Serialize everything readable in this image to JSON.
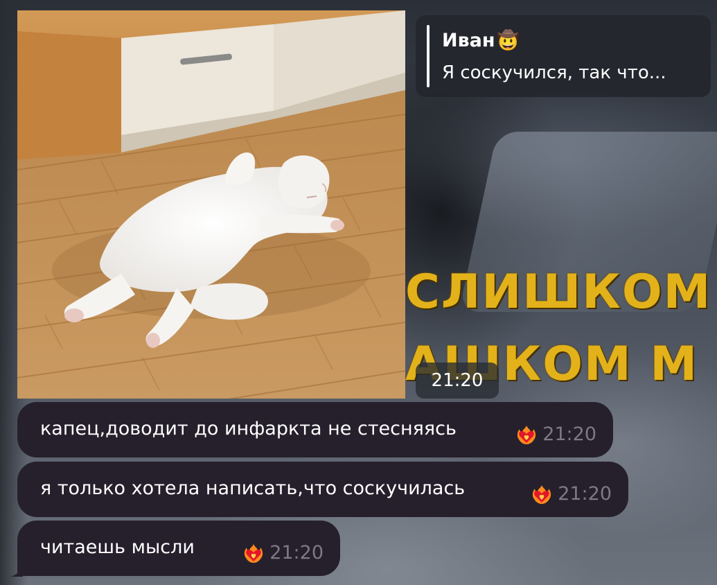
{
  "wallpaper": {
    "subtitle_line1": "СЛИШКОМ М",
    "subtitle_line2": "АШКОМ М"
  },
  "photo_message": {
    "time": "21:20"
  },
  "reply": {
    "author_name": "Иван",
    "author_emoji": "🤠",
    "text": "Я соскучился, так что..."
  },
  "messages": [
    {
      "text": "капец,доводит до инфаркта не стесняясь",
      "reaction": "heart-on-fire",
      "time": "21:20"
    },
    {
      "text": "я только хотела написать,что соскучилась",
      "reaction": "heart-on-fire",
      "time": "21:20"
    },
    {
      "text": "читаешь мысли",
      "reaction": "heart-on-fire",
      "time": "21:20"
    }
  ],
  "colors": {
    "bubble_bg": "#26202c",
    "time_text": "#7f7986",
    "subtitle_yellow": "#e3b21a"
  }
}
